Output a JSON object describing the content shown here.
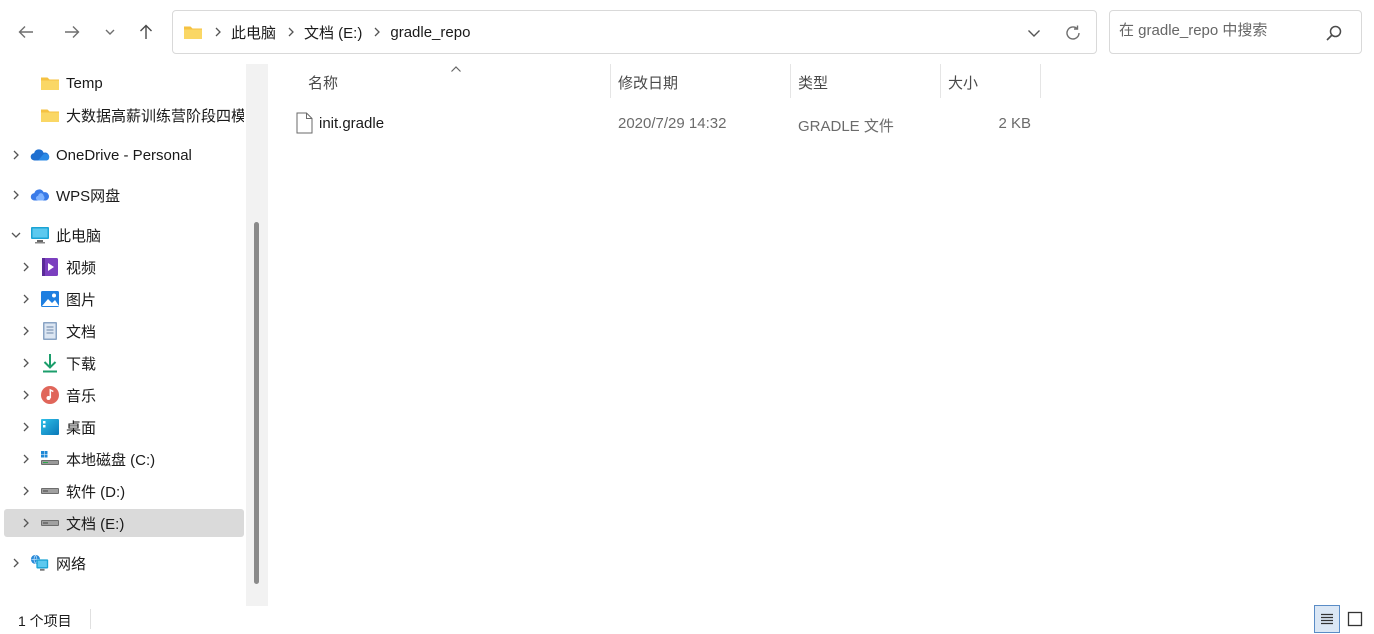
{
  "toolbar": {
    "back_icon": "arrow-left-icon",
    "forward_icon": "arrow-right-icon",
    "recent_icon": "chevron-down-icon",
    "up_icon": "arrow-up-icon"
  },
  "address_bar": {
    "breadcrumbs": [
      "此电脑",
      "文档 (E:)",
      "gradle_repo"
    ]
  },
  "search": {
    "placeholder": "在 gradle_repo 中搜索"
  },
  "nav_pane": {
    "items": [
      {
        "label": "Temp",
        "icon": "folder-icon",
        "expandable": false,
        "level": 1
      },
      {
        "label": "大数据高薪训练营阶段四模",
        "icon": "folder-icon",
        "expandable": false,
        "level": 1
      },
      {
        "label": "OneDrive - Personal",
        "icon": "onedrive-icon",
        "expandable": true,
        "level": 0
      },
      {
        "label": "WPS网盘",
        "icon": "wps-cloud-icon",
        "expandable": true,
        "level": 0
      },
      {
        "label": "此电脑",
        "icon": "computer-icon",
        "expandable": true,
        "expanded": true,
        "level": 0
      },
      {
        "label": "视频",
        "icon": "videos-icon",
        "expandable": true,
        "level": 1
      },
      {
        "label": "图片",
        "icon": "pictures-icon",
        "expandable": true,
        "level": 1
      },
      {
        "label": "文档",
        "icon": "documents-icon",
        "expandable": true,
        "level": 1
      },
      {
        "label": "下载",
        "icon": "download-icon",
        "expandable": true,
        "level": 1
      },
      {
        "label": "音乐",
        "icon": "music-icon",
        "expandable": true,
        "level": 1
      },
      {
        "label": "桌面",
        "icon": "desktop-icon",
        "expandable": true,
        "level": 1
      },
      {
        "label": "本地磁盘 (C:)",
        "icon": "system-drive-icon",
        "expandable": true,
        "level": 1
      },
      {
        "label": "软件 (D:)",
        "icon": "drive-icon",
        "expandable": true,
        "level": 1
      },
      {
        "label": "文档 (E:)",
        "icon": "drive-icon",
        "expandable": true,
        "level": 1,
        "selected": true
      },
      {
        "label": "网络",
        "icon": "network-icon",
        "expandable": true,
        "level": 0
      }
    ]
  },
  "file_list": {
    "columns": [
      "名称",
      "修改日期",
      "类型",
      "大小"
    ],
    "rows": [
      {
        "name": "init.gradle",
        "modified": "2020/7/29 14:32",
        "type": "GRADLE 文件",
        "size": "2 KB",
        "icon": "file-icon"
      }
    ]
  },
  "status_bar": {
    "item_count": "1 个项目"
  },
  "colors": {
    "selection": "#dadada",
    "folder": "#f5c242",
    "accent": "#0a64c8"
  }
}
